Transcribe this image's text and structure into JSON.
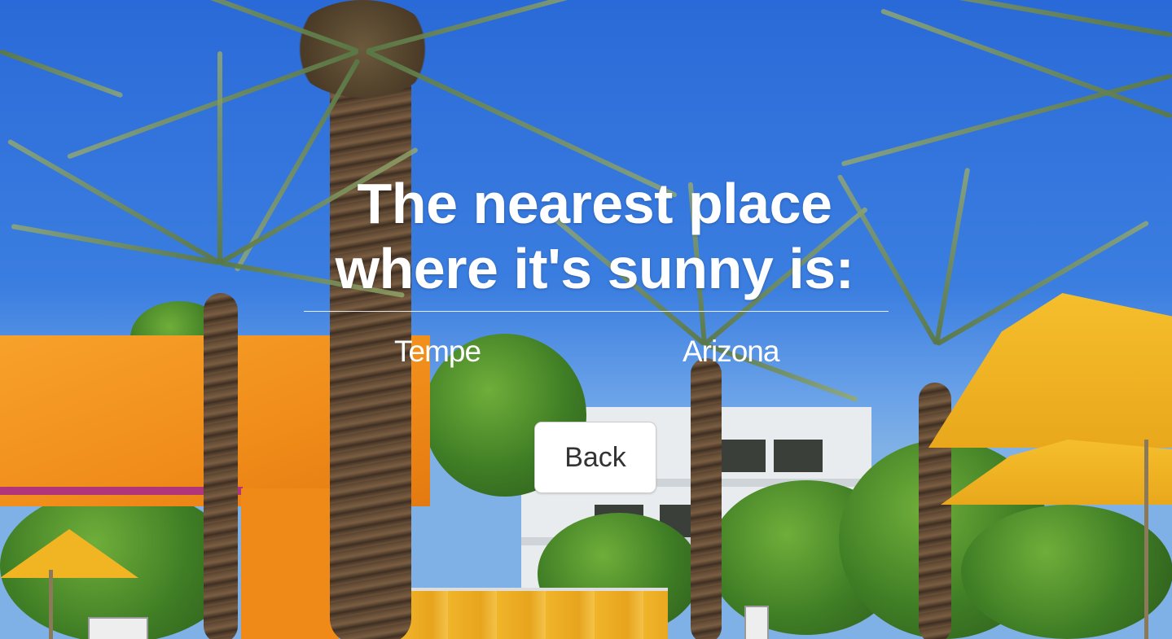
{
  "heading": {
    "line1": "The nearest place",
    "line2": "where it's sunny is:"
  },
  "location": {
    "city": "Tempe",
    "region": "Arizona"
  },
  "actions": {
    "back_label": "Back"
  },
  "colors": {
    "text": "#ffffff",
    "button_bg": "#ffffff",
    "button_text": "#333333",
    "sky": "#2a6ad8",
    "wall": "#f08c1a",
    "umbrella": "#f5be2c"
  },
  "background": {
    "description_icon": "resort-palm-trees-photo"
  }
}
